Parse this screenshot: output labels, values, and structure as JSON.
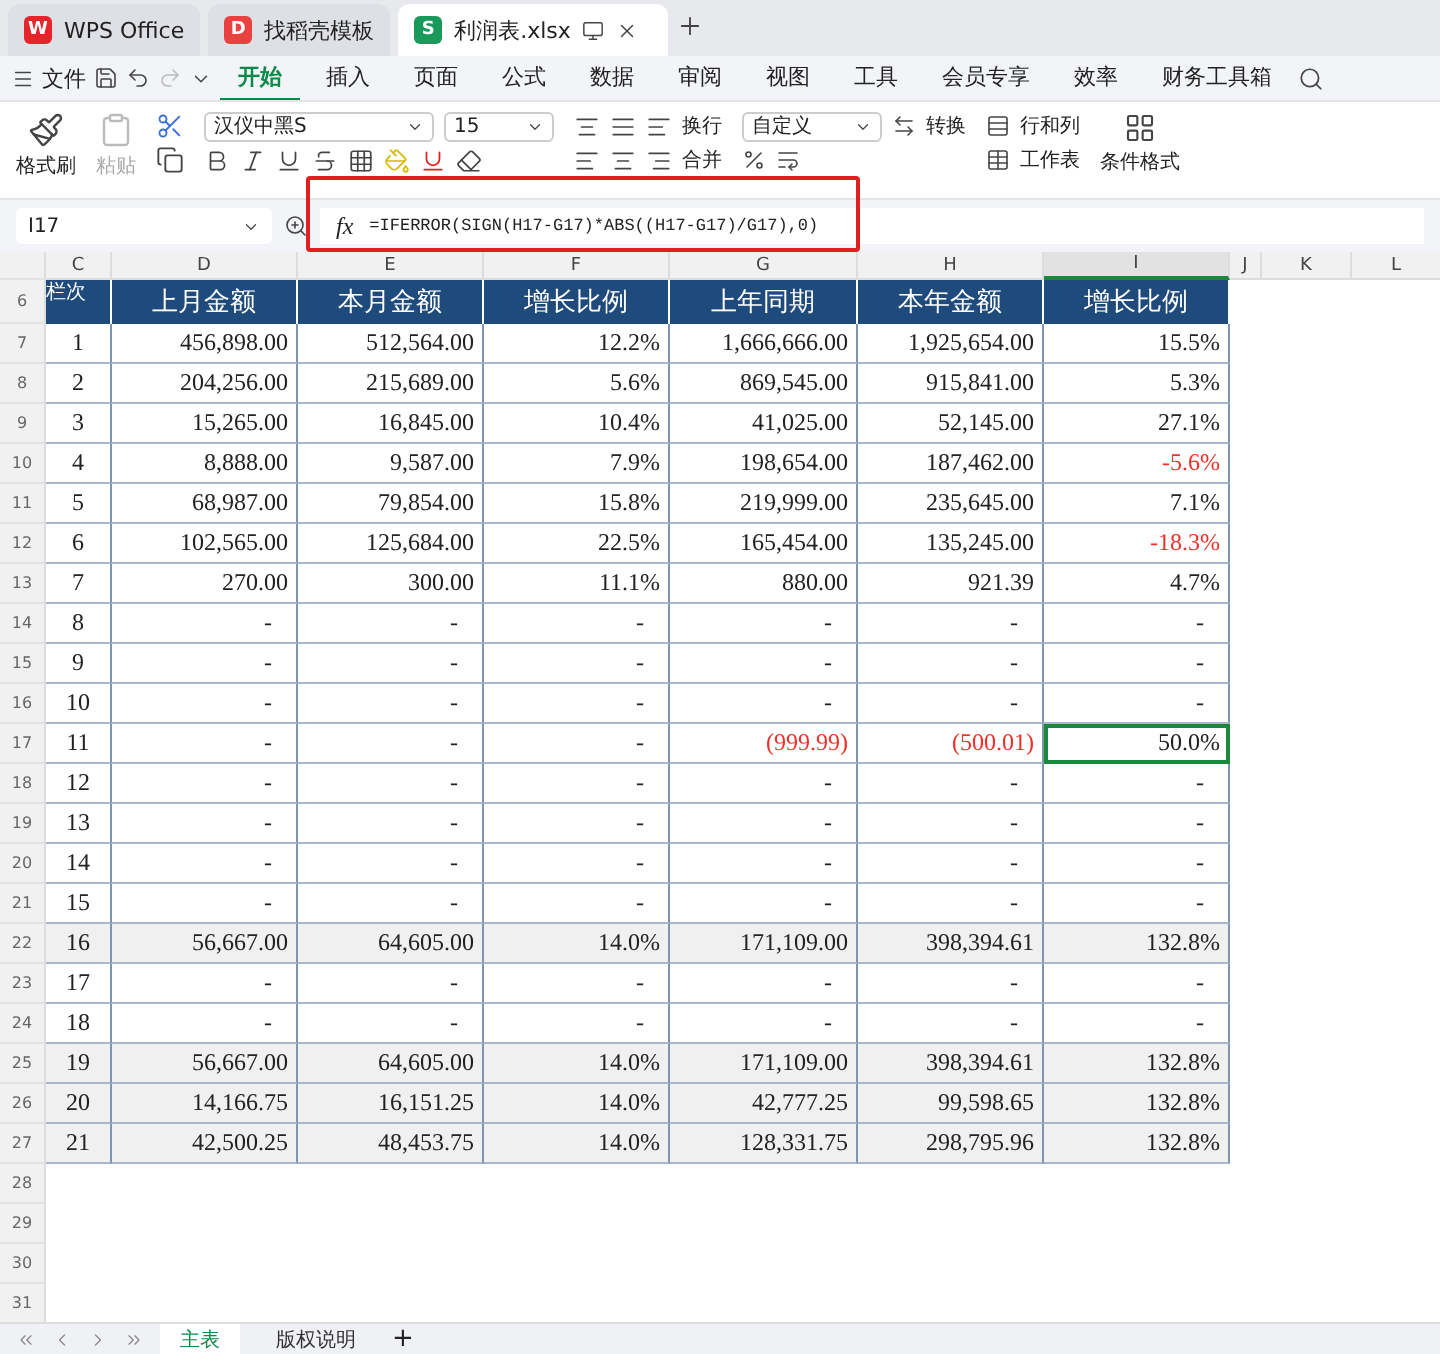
{
  "window": {
    "tabs": [
      {
        "label": "WPS Office",
        "kind": "home",
        "logo": "W",
        "selected": false
      },
      {
        "label": "找稻壳模板",
        "kind": "template",
        "logo": "D",
        "selected": false
      },
      {
        "label": "利润表.xlsx",
        "kind": "sheet",
        "logo": "S",
        "selected": true
      }
    ]
  },
  "menu": {
    "file": "文件",
    "tabs": [
      {
        "label": "开始",
        "selected": true
      },
      {
        "label": "插入",
        "selected": false
      },
      {
        "label": "页面",
        "selected": false
      },
      {
        "label": "公式",
        "selected": false
      },
      {
        "label": "数据",
        "selected": false
      },
      {
        "label": "审阅",
        "selected": false
      },
      {
        "label": "视图",
        "selected": false
      },
      {
        "label": "工具",
        "selected": false
      },
      {
        "label": "会员专享",
        "selected": false
      },
      {
        "label": "效率",
        "selected": false
      },
      {
        "label": "财务工具箱",
        "selected": false
      }
    ]
  },
  "ribbon": {
    "format_painter": "格式刷",
    "paste": {
      "label": "粘贴",
      "disabled": true
    },
    "font_name": "汉仪中黑S",
    "font_size": "15",
    "wrap": "换行",
    "merge": "合并",
    "number_format": "自定义",
    "convert": "转换",
    "rows_cols": "行和列",
    "worksheet": "工作表",
    "conditional": "条件格式"
  },
  "formula_bar": {
    "cell": "I17",
    "fx": "fx",
    "formula": "=IFERROR(SIGN(H17-G17)*ABS((H17-G17)/G17),0)",
    "highlighted": true
  },
  "sheet": {
    "columns": [
      {
        "label": "C",
        "selected": false
      },
      {
        "label": "D",
        "selected": false
      },
      {
        "label": "E",
        "selected": false
      },
      {
        "label": "F",
        "selected": false
      },
      {
        "label": "G",
        "selected": false
      },
      {
        "label": "H",
        "selected": false
      },
      {
        "label": "I",
        "selected": true
      },
      {
        "label": "J",
        "selected": false
      },
      {
        "label": "K",
        "selected": false
      },
      {
        "label": "L",
        "selected": false
      }
    ],
    "header_row": "6",
    "header": [
      "栏次",
      "上月金额",
      "本月金额",
      "增长比例",
      "上年同期",
      "本年金额",
      "增长比例"
    ],
    "rows": [
      {
        "row": "7",
        "no": "1",
        "shaded": false,
        "cells": [
          {
            "text": "456,898.00",
            "negative": false,
            "selected": false
          },
          {
            "text": "512,564.00",
            "negative": false,
            "selected": false
          },
          {
            "text": "12.2%",
            "negative": false,
            "selected": false
          },
          {
            "text": "1,666,666.00",
            "negative": false,
            "selected": false
          },
          {
            "text": "1,925,654.00",
            "negative": false,
            "selected": false
          },
          {
            "text": "15.5%",
            "negative": false,
            "selected": false
          }
        ]
      },
      {
        "row": "8",
        "no": "2",
        "shaded": false,
        "cells": [
          {
            "text": "204,256.00",
            "negative": false,
            "selected": false
          },
          {
            "text": "215,689.00",
            "negative": false,
            "selected": false
          },
          {
            "text": "5.6%",
            "negative": false,
            "selected": false
          },
          {
            "text": "869,545.00",
            "negative": false,
            "selected": false
          },
          {
            "text": "915,841.00",
            "negative": false,
            "selected": false
          },
          {
            "text": "5.3%",
            "negative": false,
            "selected": false
          }
        ]
      },
      {
        "row": "9",
        "no": "3",
        "shaded": false,
        "cells": [
          {
            "text": "15,265.00",
            "negative": false,
            "selected": false
          },
          {
            "text": "16,845.00",
            "negative": false,
            "selected": false
          },
          {
            "text": "10.4%",
            "negative": false,
            "selected": false
          },
          {
            "text": "41,025.00",
            "negative": false,
            "selected": false
          },
          {
            "text": "52,145.00",
            "negative": false,
            "selected": false
          },
          {
            "text": "27.1%",
            "negative": false,
            "selected": false
          }
        ]
      },
      {
        "row": "10",
        "no": "4",
        "shaded": false,
        "cells": [
          {
            "text": "8,888.00",
            "negative": false,
            "selected": false
          },
          {
            "text": "9,587.00",
            "negative": false,
            "selected": false
          },
          {
            "text": "7.9%",
            "negative": false,
            "selected": false
          },
          {
            "text": "198,654.00",
            "negative": false,
            "selected": false
          },
          {
            "text": "187,462.00",
            "negative": false,
            "selected": false
          },
          {
            "text": "-5.6%",
            "negative": true,
            "selected": false
          }
        ]
      },
      {
        "row": "11",
        "no": "5",
        "shaded": false,
        "cells": [
          {
            "text": "68,987.00",
            "negative": false,
            "selected": false
          },
          {
            "text": "79,854.00",
            "negative": false,
            "selected": false
          },
          {
            "text": "15.8%",
            "negative": false,
            "selected": false
          },
          {
            "text": "219,999.00",
            "negative": false,
            "selected": false
          },
          {
            "text": "235,645.00",
            "negative": false,
            "selected": false
          },
          {
            "text": "7.1%",
            "negative": false,
            "selected": false
          }
        ]
      },
      {
        "row": "12",
        "no": "6",
        "shaded": false,
        "cells": [
          {
            "text": "102,565.00",
            "negative": false,
            "selected": false
          },
          {
            "text": "125,684.00",
            "negative": false,
            "selected": false
          },
          {
            "text": "22.5%",
            "negative": false,
            "selected": false
          },
          {
            "text": "165,454.00",
            "negative": false,
            "selected": false
          },
          {
            "text": "135,245.00",
            "negative": false,
            "selected": false
          },
          {
            "text": "-18.3%",
            "negative": true,
            "selected": false
          }
        ]
      },
      {
        "row": "13",
        "no": "7",
        "shaded": false,
        "cells": [
          {
            "text": "270.00",
            "negative": false,
            "selected": false
          },
          {
            "text": "300.00",
            "negative": false,
            "selected": false
          },
          {
            "text": "11.1%",
            "negative": false,
            "selected": false
          },
          {
            "text": "880.00",
            "negative": false,
            "selected": false
          },
          {
            "text": "921.39",
            "negative": false,
            "selected": false
          },
          {
            "text": "4.7%",
            "negative": false,
            "selected": false
          }
        ]
      },
      {
        "row": "14",
        "no": "8",
        "shaded": false,
        "cells": [
          {
            "text": "-",
            "negative": false,
            "selected": false
          },
          {
            "text": "-",
            "negative": false,
            "selected": false
          },
          {
            "text": "-",
            "negative": false,
            "selected": false
          },
          {
            "text": "-",
            "negative": false,
            "selected": false
          },
          {
            "text": "-",
            "negative": false,
            "selected": false
          },
          {
            "text": "-",
            "negative": false,
            "selected": false
          }
        ]
      },
      {
        "row": "15",
        "no": "9",
        "shaded": false,
        "cells": [
          {
            "text": "-",
            "negative": false,
            "selected": false
          },
          {
            "text": "-",
            "negative": false,
            "selected": false
          },
          {
            "text": "-",
            "negative": false,
            "selected": false
          },
          {
            "text": "-",
            "negative": false,
            "selected": false
          },
          {
            "text": "-",
            "negative": false,
            "selected": false
          },
          {
            "text": "-",
            "negative": false,
            "selected": false
          }
        ]
      },
      {
        "row": "16",
        "no": "10",
        "shaded": false,
        "cells": [
          {
            "text": "-",
            "negative": false,
            "selected": false
          },
          {
            "text": "-",
            "negative": false,
            "selected": false
          },
          {
            "text": "-",
            "negative": false,
            "selected": false
          },
          {
            "text": "-",
            "negative": false,
            "selected": false
          },
          {
            "text": "-",
            "negative": false,
            "selected": false
          },
          {
            "text": "-",
            "negative": false,
            "selected": false
          }
        ]
      },
      {
        "row": "17",
        "no": "11",
        "shaded": false,
        "cells": [
          {
            "text": "-",
            "negative": false,
            "selected": false
          },
          {
            "text": "-",
            "negative": false,
            "selected": false
          },
          {
            "text": "-",
            "negative": false,
            "selected": false
          },
          {
            "text": "(999.99)",
            "negative": true,
            "selected": false
          },
          {
            "text": "(500.01)",
            "negative": true,
            "selected": false
          },
          {
            "text": "50.0%",
            "negative": false,
            "selected": true
          }
        ]
      },
      {
        "row": "18",
        "no": "12",
        "shaded": false,
        "cells": [
          {
            "text": "-",
            "negative": false,
            "selected": false
          },
          {
            "text": "-",
            "negative": false,
            "selected": false
          },
          {
            "text": "-",
            "negative": false,
            "selected": false
          },
          {
            "text": "-",
            "negative": false,
            "selected": false
          },
          {
            "text": "-",
            "negative": false,
            "selected": false
          },
          {
            "text": "-",
            "negative": false,
            "selected": false
          }
        ]
      },
      {
        "row": "19",
        "no": "13",
        "shaded": false,
        "cells": [
          {
            "text": "-",
            "negative": false,
            "selected": false
          },
          {
            "text": "-",
            "negative": false,
            "selected": false
          },
          {
            "text": "-",
            "negative": false,
            "selected": false
          },
          {
            "text": "-",
            "negative": false,
            "selected": false
          },
          {
            "text": "-",
            "negative": false,
            "selected": false
          },
          {
            "text": "-",
            "negative": false,
            "selected": false
          }
        ]
      },
      {
        "row": "20",
        "no": "14",
        "shaded": false,
        "cells": [
          {
            "text": "-",
            "negative": false,
            "selected": false
          },
          {
            "text": "-",
            "negative": false,
            "selected": false
          },
          {
            "text": "-",
            "negative": false,
            "selected": false
          },
          {
            "text": "-",
            "negative": false,
            "selected": false
          },
          {
            "text": "-",
            "negative": false,
            "selected": false
          },
          {
            "text": "-",
            "negative": false,
            "selected": false
          }
        ]
      },
      {
        "row": "21",
        "no": "15",
        "shaded": false,
        "cells": [
          {
            "text": "-",
            "negative": false,
            "selected": false
          },
          {
            "text": "-",
            "negative": false,
            "selected": false
          },
          {
            "text": "-",
            "negative": false,
            "selected": false
          },
          {
            "text": "-",
            "negative": false,
            "selected": false
          },
          {
            "text": "-",
            "negative": false,
            "selected": false
          },
          {
            "text": "-",
            "negative": false,
            "selected": false
          }
        ]
      },
      {
        "row": "22",
        "no": "16",
        "shaded": true,
        "cells": [
          {
            "text": "56,667.00",
            "negative": false,
            "selected": false
          },
          {
            "text": "64,605.00",
            "negative": false,
            "selected": false
          },
          {
            "text": "14.0%",
            "negative": false,
            "selected": false
          },
          {
            "text": "171,109.00",
            "negative": false,
            "selected": false
          },
          {
            "text": "398,394.61",
            "negative": false,
            "selected": false
          },
          {
            "text": "132.8%",
            "negative": false,
            "selected": false
          }
        ]
      },
      {
        "row": "23",
        "no": "17",
        "shaded": false,
        "cells": [
          {
            "text": "-",
            "negative": false,
            "selected": false
          },
          {
            "text": "-",
            "negative": false,
            "selected": false
          },
          {
            "text": "-",
            "negative": false,
            "selected": false
          },
          {
            "text": "-",
            "negative": false,
            "selected": false
          },
          {
            "text": "-",
            "negative": false,
            "selected": false
          },
          {
            "text": "-",
            "negative": false,
            "selected": false
          }
        ]
      },
      {
        "row": "24",
        "no": "18",
        "shaded": false,
        "cells": [
          {
            "text": "-",
            "negative": false,
            "selected": false
          },
          {
            "text": "-",
            "negative": false,
            "selected": false
          },
          {
            "text": "-",
            "negative": false,
            "selected": false
          },
          {
            "text": "-",
            "negative": false,
            "selected": false
          },
          {
            "text": "-",
            "negative": false,
            "selected": false
          },
          {
            "text": "-",
            "negative": false,
            "selected": false
          }
        ]
      },
      {
        "row": "25",
        "no": "19",
        "shaded": true,
        "cells": [
          {
            "text": "56,667.00",
            "negative": false,
            "selected": false
          },
          {
            "text": "64,605.00",
            "negative": false,
            "selected": false
          },
          {
            "text": "14.0%",
            "negative": false,
            "selected": false
          },
          {
            "text": "171,109.00",
            "negative": false,
            "selected": false
          },
          {
            "text": "398,394.61",
            "negative": false,
            "selected": false
          },
          {
            "text": "132.8%",
            "negative": false,
            "selected": false
          }
        ]
      },
      {
        "row": "26",
        "no": "20",
        "shaded": true,
        "cells": [
          {
            "text": "14,166.75",
            "negative": false,
            "selected": false
          },
          {
            "text": "16,151.25",
            "negative": false,
            "selected": false
          },
          {
            "text": "14.0%",
            "negative": false,
            "selected": false
          },
          {
            "text": "42,777.25",
            "negative": false,
            "selected": false
          },
          {
            "text": "99,598.65",
            "negative": false,
            "selected": false
          },
          {
            "text": "132.8%",
            "negative": false,
            "selected": false
          }
        ]
      },
      {
        "row": "27",
        "no": "21",
        "shaded": true,
        "cells": [
          {
            "text": "42,500.25",
            "negative": false,
            "selected": false
          },
          {
            "text": "48,453.75",
            "negative": false,
            "selected": false
          },
          {
            "text": "14.0%",
            "negative": false,
            "selected": false
          },
          {
            "text": "128,331.75",
            "negative": false,
            "selected": false
          },
          {
            "text": "298,795.96",
            "negative": false,
            "selected": false
          },
          {
            "text": "132.8%",
            "negative": false,
            "selected": false
          }
        ]
      }
    ],
    "empty_rows": [
      "28",
      "29",
      "30",
      "31"
    ]
  },
  "sheet_tabs": [
    {
      "label": "主表",
      "selected": true
    },
    {
      "label": "版权说明",
      "selected": false
    }
  ],
  "add_sheet": "+"
}
